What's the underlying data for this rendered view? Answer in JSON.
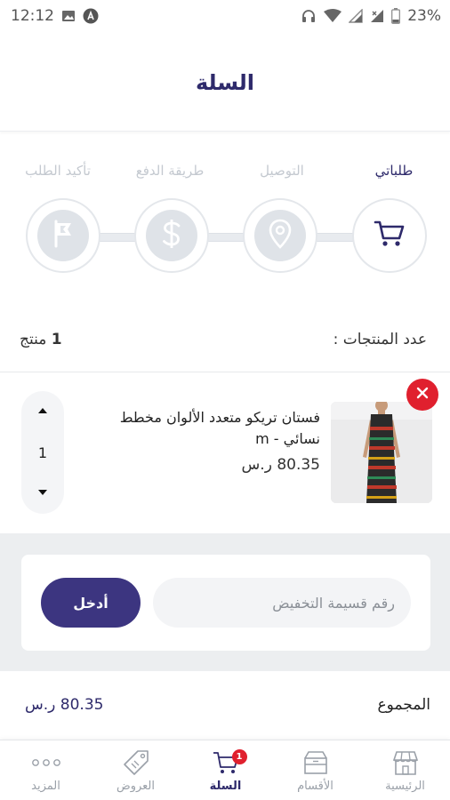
{
  "status_bar": {
    "time": "12:12",
    "battery": "23%",
    "icons": [
      "image-icon",
      "notification-a-icon",
      "headphones-icon",
      "wifi-icon",
      "signal-icon",
      "battery-icon"
    ]
  },
  "header": {
    "title": "السلة"
  },
  "steps": [
    {
      "label": "طلباتي",
      "icon": "cart-icon",
      "active": true
    },
    {
      "label": "التوصيل",
      "icon": "location-pin-icon",
      "active": false
    },
    {
      "label": "طريقة الدفع",
      "icon": "dollar-icon",
      "active": false
    },
    {
      "label": "تأكيد الطلب",
      "icon": "flag-icon",
      "active": false
    }
  ],
  "cart": {
    "count_label": "عدد المنتجات :",
    "count_value": "1",
    "count_unit": "منتج",
    "items": [
      {
        "name": "فستان تريكو متعدد الألوان مخطط نسائي - m",
        "price": "80.35 ر.س",
        "quantity": "1"
      }
    ]
  },
  "coupon": {
    "placeholder": "رقم قسيمة التخفيض",
    "button_label": "أدخل"
  },
  "total": {
    "label": "المجموع",
    "value": "80.35 ر.س"
  },
  "bottom_nav": [
    {
      "label": "الرئيسية",
      "icon": "store-icon",
      "active": false
    },
    {
      "label": "الأقسام",
      "icon": "categories-box-icon",
      "active": false
    },
    {
      "label": "السلة",
      "icon": "cart-icon",
      "active": true,
      "badge": "1"
    },
    {
      "label": "العروض",
      "icon": "tag-icon",
      "active": false
    },
    {
      "label": "المزيد",
      "icon": "more-dots-icon",
      "active": false
    }
  ],
  "colors": {
    "primary": "#2e2a6b",
    "button": "#3c3580",
    "danger": "#e0202e",
    "inactive": "#c4c9d0"
  }
}
